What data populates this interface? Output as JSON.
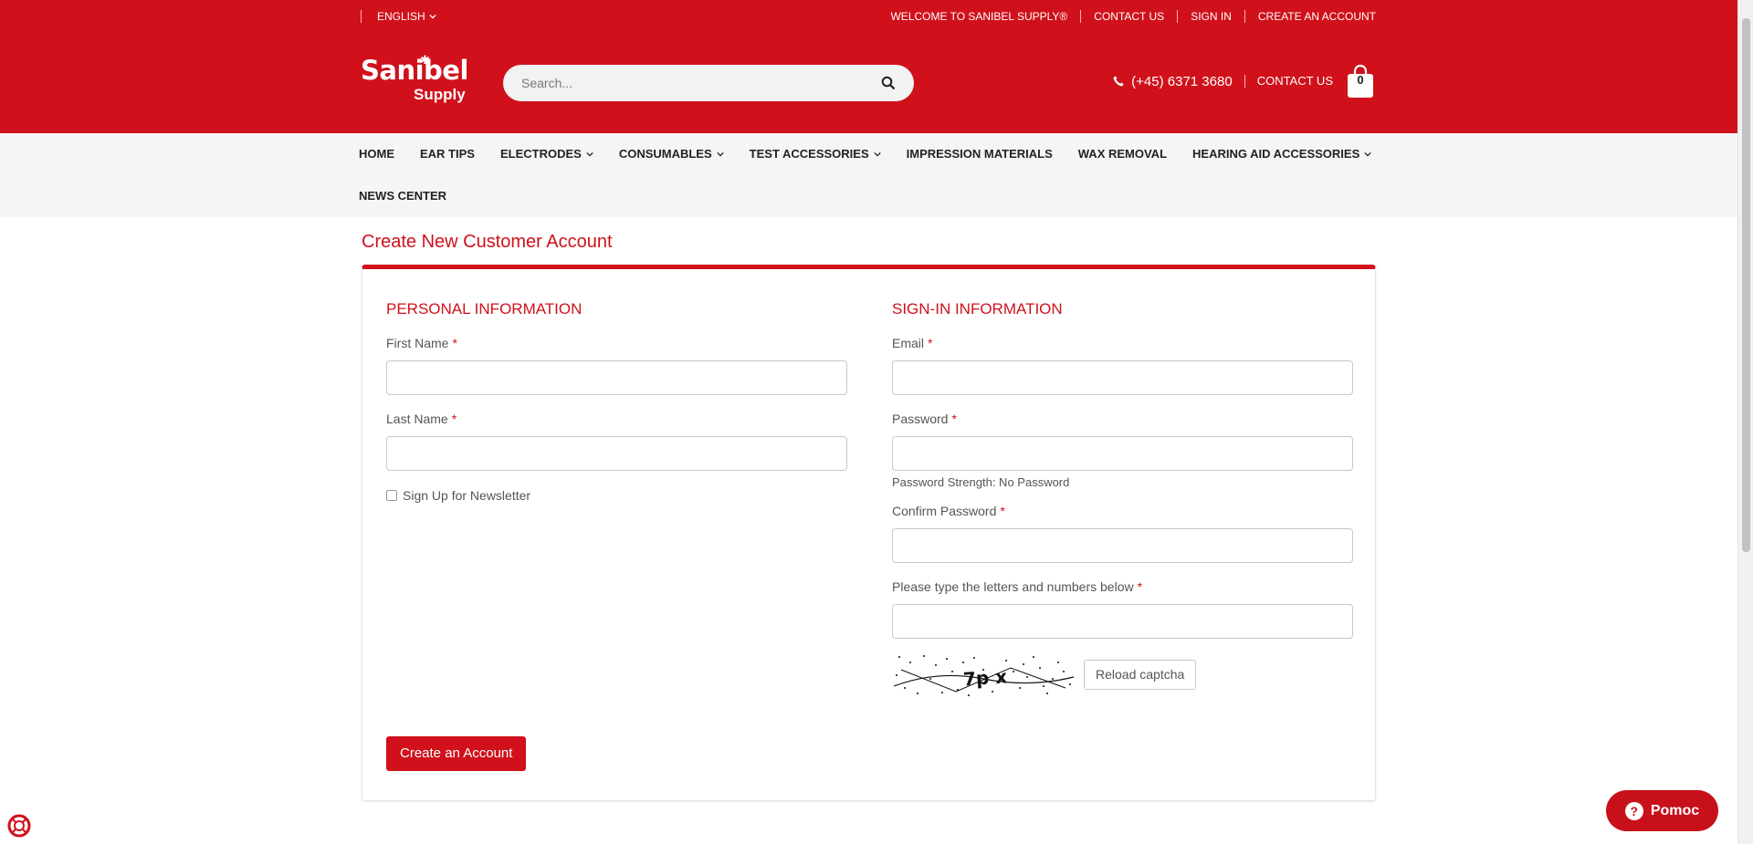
{
  "topbar": {
    "language": "ENGLISH",
    "links": [
      "WELCOME TO SANIBEL SUPPLY®",
      "CONTACT US",
      "SIGN IN",
      "CREATE AN ACCOUNT"
    ]
  },
  "brand": {
    "line1": "Sanibel",
    "line2": "Supply"
  },
  "search": {
    "placeholder": "Search..."
  },
  "header": {
    "phone": "(+45) 6371 3680",
    "contact": "CONTACT US",
    "cart_count": "0"
  },
  "nav": {
    "row1": [
      {
        "label": "HOME",
        "dropdown": false
      },
      {
        "label": "EAR TIPS",
        "dropdown": false
      },
      {
        "label": "ELECTRODES",
        "dropdown": true
      },
      {
        "label": "CONSUMABLES",
        "dropdown": true
      },
      {
        "label": "TEST ACCESSORIES",
        "dropdown": true
      },
      {
        "label": "IMPRESSION MATERIALS",
        "dropdown": false
      },
      {
        "label": "WAX REMOVAL",
        "dropdown": false
      },
      {
        "label": "HEARING AID ACCESSORIES",
        "dropdown": true
      }
    ],
    "row2": [
      {
        "label": "NEWS CENTER",
        "dropdown": false
      }
    ]
  },
  "page": {
    "title": "Create New Customer Account"
  },
  "personal": {
    "title": "PERSONAL INFORMATION",
    "first_name": "First Name",
    "last_name": "Last Name",
    "newsletter": "Sign Up for Newsletter",
    "required_mark": "*"
  },
  "signin": {
    "title": "SIGN-IN INFORMATION",
    "email": "Email",
    "password": "Password",
    "strength": "Password Strength: No Password",
    "confirm": "Confirm Password",
    "captcha_label": "Please type the letters and numbers below",
    "reload": "Reload captcha"
  },
  "actions": {
    "submit": "Create an Account"
  },
  "help": {
    "label": "Pomoc"
  },
  "colors": {
    "brand_red": "#d0111b",
    "nav_bg": "#f5f5f5"
  }
}
